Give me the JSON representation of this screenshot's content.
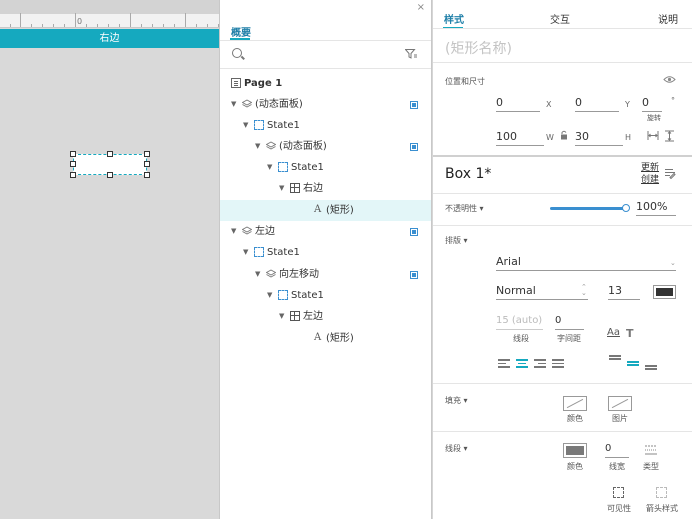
{
  "canvas": {
    "ruler_zero": "0",
    "bar_label": "右边"
  },
  "outline": {
    "close": "×",
    "tab": "概要",
    "tree": [
      {
        "label": "Page 1",
        "icon": "page-icon",
        "visible_toggle": false
      },
      {
        "label": "(动态面板)",
        "icon": "layers-icon",
        "visible_toggle": true
      },
      {
        "label": "State1",
        "icon": "state-icon",
        "visible_toggle": false
      },
      {
        "label": "(动态面板)",
        "icon": "layers-icon",
        "visible_toggle": true
      },
      {
        "label": "State1",
        "icon": "state-icon",
        "visible_toggle": false
      },
      {
        "label": "右边",
        "icon": "grid-icon",
        "visible_toggle": false
      },
      {
        "label": "(矩形)",
        "icon": "text-icon",
        "visible_toggle": false,
        "selected": true
      },
      {
        "label": "左边",
        "icon": "layers-icon",
        "visible_toggle": true
      },
      {
        "label": "State1",
        "icon": "state-icon",
        "visible_toggle": false
      },
      {
        "label": "向左移动",
        "icon": "layers-icon",
        "visible_toggle": true
      },
      {
        "label": "State1",
        "icon": "state-icon",
        "visible_toggle": false
      },
      {
        "label": "左边",
        "icon": "grid-icon",
        "visible_toggle": false
      },
      {
        "label": "(矩形)",
        "icon": "text-icon",
        "visible_toggle": false
      }
    ]
  },
  "props": {
    "tabs": {
      "style": "样式",
      "interaction": "交互",
      "notes": "说明"
    },
    "shape_name_placeholder": "(矩形名称)",
    "position": {
      "title": "位置和尺寸",
      "x": "0",
      "x_unit": "X",
      "y": "0",
      "y_unit": "Y",
      "rotation": "0",
      "rotation_unit": "°",
      "rotation_label": "旋转",
      "w": "100",
      "w_unit": "W",
      "h": "30",
      "h_unit": "H"
    },
    "style_name": "Box 1*",
    "update_create": [
      "更新",
      "创建"
    ],
    "opacity": {
      "label": "不透明性 ▾",
      "value": "100%",
      "level": 1.0
    },
    "typography": {
      "title": "排版 ▾",
      "font": "Arial",
      "weight": "Normal",
      "size": "13",
      "color": "#333333",
      "line_spacing": "15 (auto)",
      "line_spacing_label": "线段",
      "char_spacing": "0",
      "char_spacing_label": "字间距"
    },
    "fill": {
      "title": "填充 ▾",
      "color_label": "颜色",
      "image_label": "图片"
    },
    "border": {
      "title": "线段 ▾",
      "color_label": "颜色",
      "color": "#797979",
      "width": "0",
      "width_label": "线宽",
      "type_label": "类型",
      "visibility_label": "可见性",
      "arrow_label": "箭头样式"
    }
  }
}
